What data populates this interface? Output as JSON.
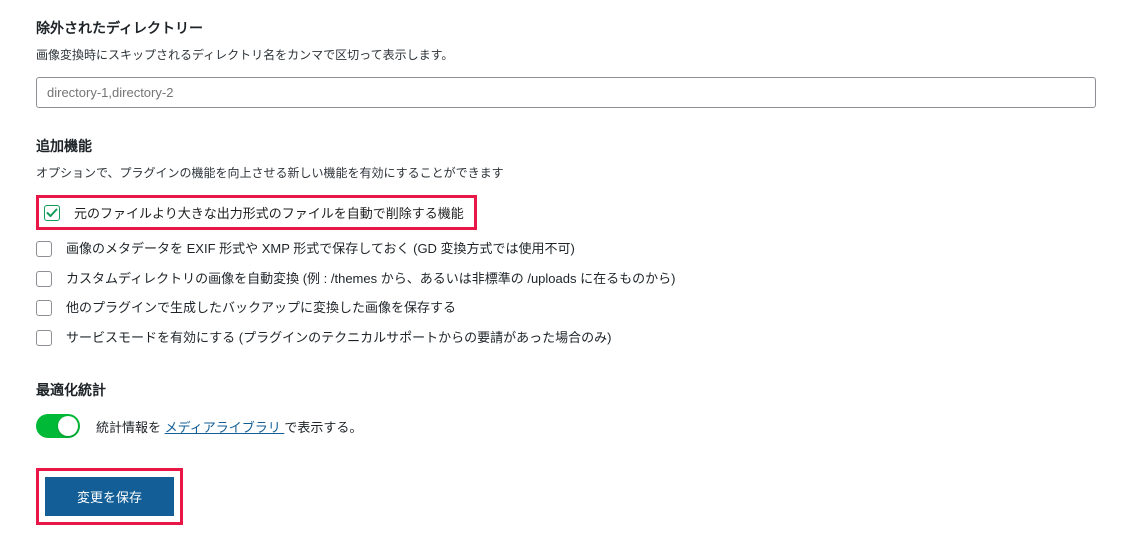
{
  "excluded": {
    "title": "除外されたディレクトリー",
    "desc": "画像変換時にスキップされるディレクトリ名をカンマで区切って表示します。",
    "placeholder": "directory-1,directory-2"
  },
  "features": {
    "title": "追加機能",
    "desc": "オプションで、プラグインの機能を向上させる新しい機能を有効にすることができます",
    "items": [
      {
        "label": "元のファイルより大きな出力形式のファイルを自動で削除する機能",
        "checked": true
      },
      {
        "label": "画像のメタデータを EXIF 形式や XMP 形式で保存しておく (GD 変換方式では使用不可)",
        "checked": false
      },
      {
        "label": "カスタムディレクトリの画像を自動変換 (例 : /themes から、あるいは非標準の /uploads に在るものから)",
        "checked": false
      },
      {
        "label": "他のプラグインで生成したバックアップに変換した画像を保存する",
        "checked": false
      },
      {
        "label": "サービスモードを有効にする (プラグインのテクニカルサポートからの要請があった場合のみ)",
        "checked": false
      }
    ]
  },
  "stats": {
    "title": "最適化統計",
    "text_before": "統計情報を ",
    "link": "メディアライブラリ ",
    "text_after": "で表示する。"
  },
  "save_label": "変更を保存"
}
